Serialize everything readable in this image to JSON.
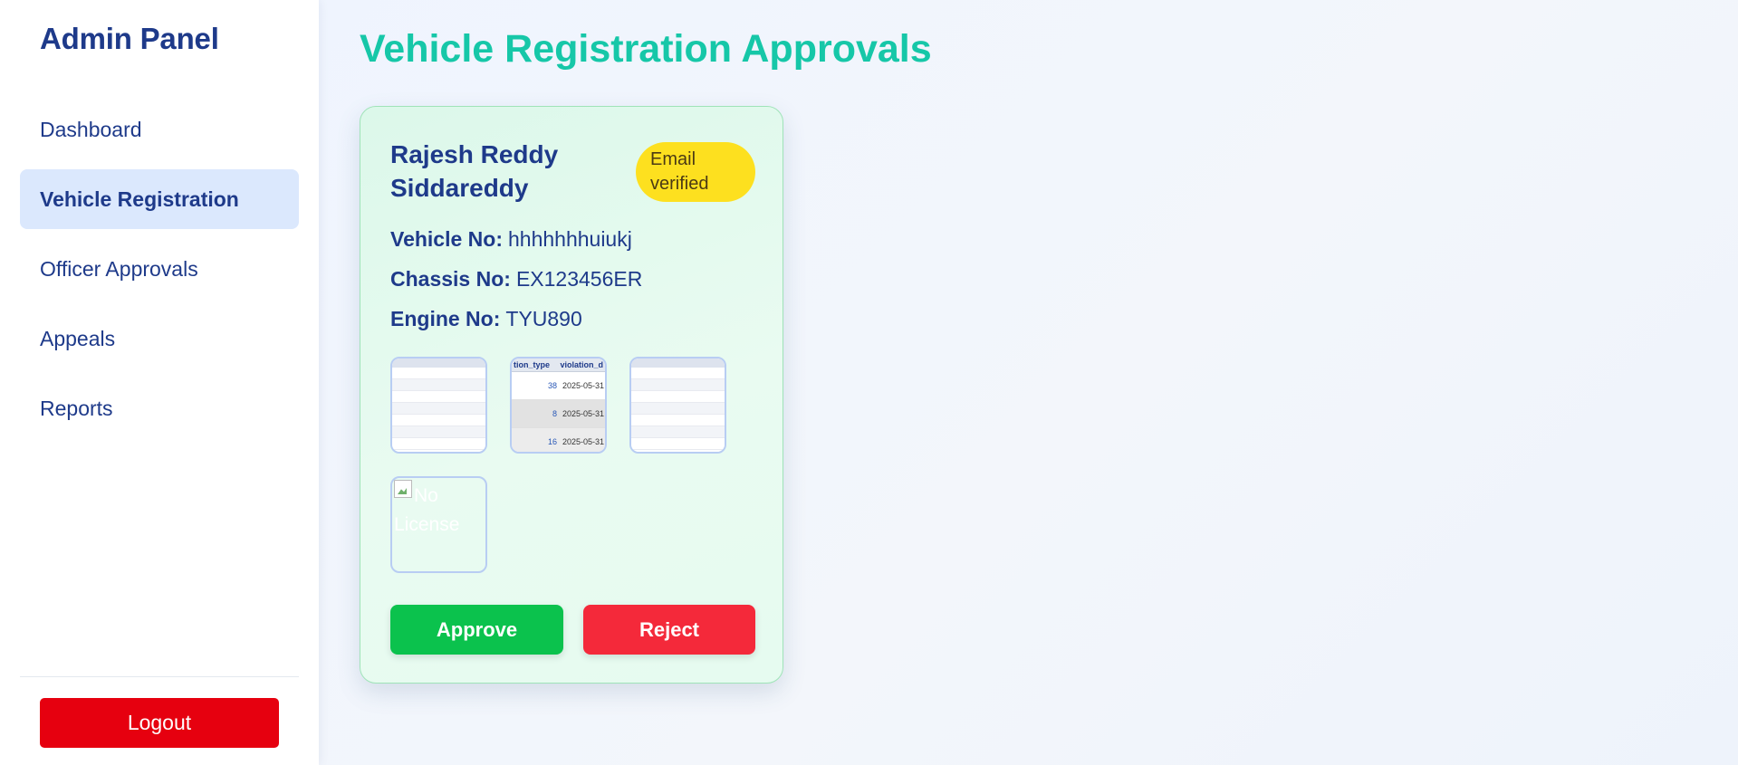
{
  "sidebar": {
    "title": "Admin Panel",
    "items": [
      {
        "label": "Dashboard",
        "active": false
      },
      {
        "label": "Vehicle Registration",
        "active": true
      },
      {
        "label": "Officer Approvals",
        "active": false
      },
      {
        "label": "Appeals",
        "active": false
      },
      {
        "label": "Reports",
        "active": false
      }
    ],
    "logout_label": "Logout"
  },
  "main": {
    "title": "Vehicle Registration Approvals",
    "card": {
      "owner_name": "Rajesh Reddy Siddareddy",
      "status_badge": "Email verified",
      "vehicle_no_label": "Vehicle No:",
      "vehicle_no": "hhhhhhhuiukj",
      "chassis_no_label": "Chassis No:",
      "chassis_no": "EX123456ER",
      "engine_no_label": "Engine No:",
      "engine_no": "TYU890",
      "document_thumbnails": [
        {
          "kind": "spreadsheet-screenshot"
        },
        {
          "kind": "violations-table-screenshot",
          "headers": [
            "tion_type",
            "violation_d"
          ],
          "rows": [
            {
              "num": "38",
              "date": "2025-05-31"
            },
            {
              "num": "8",
              "date": "2025-05-31"
            },
            {
              "num": "16",
              "date": "2025-05-31"
            }
          ]
        },
        {
          "kind": "spreadsheet-screenshot"
        }
      ],
      "license_alt_text": "No License",
      "approve_label": "Approve",
      "reject_label": "Reject"
    }
  },
  "colors": {
    "brand": "#1e3a8a",
    "title_accent": "#16c7a8",
    "badge": "#fde01f",
    "approve": "#0bc24d",
    "reject": "#f4293a",
    "logout": "#e6000f"
  }
}
